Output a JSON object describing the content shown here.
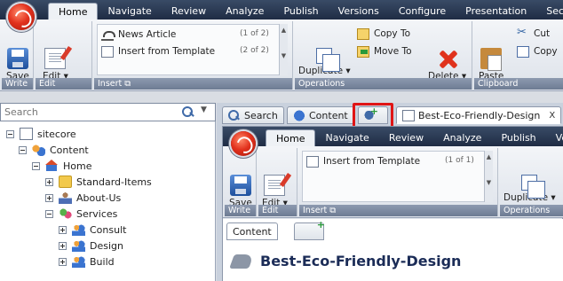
{
  "main_tabs": [
    "Home",
    "Navigate",
    "Review",
    "Analyze",
    "Publish",
    "Versions",
    "Configure",
    "Presentation",
    "Security"
  ],
  "main_tab_active_index": 0,
  "ribbon": {
    "write": {
      "group_label": "Write",
      "save_label": "Save"
    },
    "edit": {
      "group_label": "Edit",
      "edit_label": "Edit"
    },
    "insert": {
      "group_label": "Insert",
      "items": [
        {
          "label": "News Article",
          "count": "(1 of 2)",
          "icon": "news-article-icon"
        },
        {
          "label": "Insert from Template",
          "count": "(2 of 2)",
          "icon": "template-icon"
        }
      ]
    },
    "operations": {
      "group_label": "Operations",
      "duplicate_label": "Duplicate",
      "copy_to_label": "Copy To",
      "move_to_label": "Move To",
      "delete_label": "Delete"
    },
    "clipboard": {
      "group_label": "Clipboard",
      "paste_label": "Paste",
      "cut_label": "Cut",
      "copy_label": "Copy"
    }
  },
  "search": {
    "placeholder": "Search"
  },
  "tree": [
    {
      "label": "sitecore",
      "icon": "document-icon",
      "expanded": true
    },
    {
      "label": "Content",
      "icon": "content-icon",
      "expanded": true
    },
    {
      "label": "Home",
      "icon": "home-icon",
      "expanded": true
    },
    {
      "label": "Standard-Items",
      "icon": "folder-icon",
      "expanded": false
    },
    {
      "label": "About-Us",
      "icon": "person-icon",
      "expanded": false
    },
    {
      "label": "Services",
      "icon": "services-icon",
      "expanded": true
    },
    {
      "label": "Consult",
      "icon": "people-icon",
      "expanded": false
    },
    {
      "label": "Design",
      "icon": "people-icon",
      "expanded": false
    },
    {
      "label": "Build",
      "icon": "people-icon",
      "expanded": false
    }
  ],
  "editor_tabs": [
    {
      "label": "Search",
      "icon": "search-icon"
    },
    {
      "label": "Content",
      "icon": "content-icon"
    },
    {
      "label": "",
      "icon": "add-tab-icon"
    },
    {
      "label": "Best-Eco-Friendly-Design",
      "icon": "page-icon",
      "close": "X"
    }
  ],
  "inner": {
    "tabs": [
      "Home",
      "Navigate",
      "Review",
      "Analyze",
      "Publish",
      "Ver"
    ],
    "ribbon": {
      "save_label": "Save",
      "write_label": "Write",
      "edit_label": "Edit",
      "edit_group_label": "Edit",
      "insert_label": "Insert",
      "insert_item": "Insert from Template",
      "insert_count": "(1 of 1)",
      "duplicate_label": "Duplicate",
      "operations_label": "Operations"
    },
    "content_tabs": [
      "Content",
      ""
    ],
    "item_title": "Best-Eco-Friendly-Design"
  },
  "colors": {
    "highlight": "#e01515",
    "brand": "#e2311d",
    "ribbon_label_bg": "#6d7b93"
  }
}
